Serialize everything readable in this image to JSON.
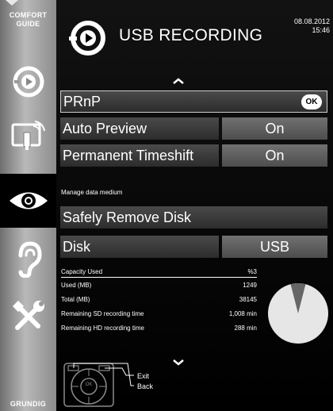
{
  "sidebar": {
    "title_line1": "COMFORT",
    "title_line2": "GUIDE",
    "brand": "GRUNDIG",
    "items": [
      {
        "icon": "record-icon"
      },
      {
        "icon": "media-device-icon"
      },
      {
        "icon": "eye-icon"
      },
      {
        "icon": "ear-icon"
      },
      {
        "icon": "tools-icon"
      }
    ],
    "active_index": 2
  },
  "header": {
    "title": "USB RECORDING",
    "date": "08.08.2012",
    "time": "15:46"
  },
  "menu": {
    "prnp_label": "PRnP",
    "ok_label": "OK",
    "auto_preview_label": "Auto Preview",
    "auto_preview_value": "On",
    "timeshift_label": "Permanent Timeshift",
    "timeshift_value": "On",
    "section_label": "Manage data medium",
    "safely_remove_label": "Safely Remove Disk",
    "disk_label": "Disk",
    "disk_value": "USB"
  },
  "stats": {
    "capacity_label": "Capacity Used",
    "capacity_value": "%3",
    "used_label": "Used (MB)",
    "used_value": "1249",
    "total_label": "Total (MB)",
    "total_value": "38145",
    "sd_label": "Remaining SD recording time",
    "sd_value": "1,008 min",
    "hd_label": "Remaining HD recording time",
    "hd_value": "288 min",
    "used_fraction": 0.03
  },
  "footer": {
    "ok_center": "OK",
    "exit_label": "Exit",
    "back_label": "Back"
  },
  "colors": {
    "panel_bg": "#0a0a0a",
    "row_dark": "#3a3a3a",
    "row_value": "#606060",
    "pie_fill": "#e6e6e6",
    "pie_used": "#666666"
  }
}
